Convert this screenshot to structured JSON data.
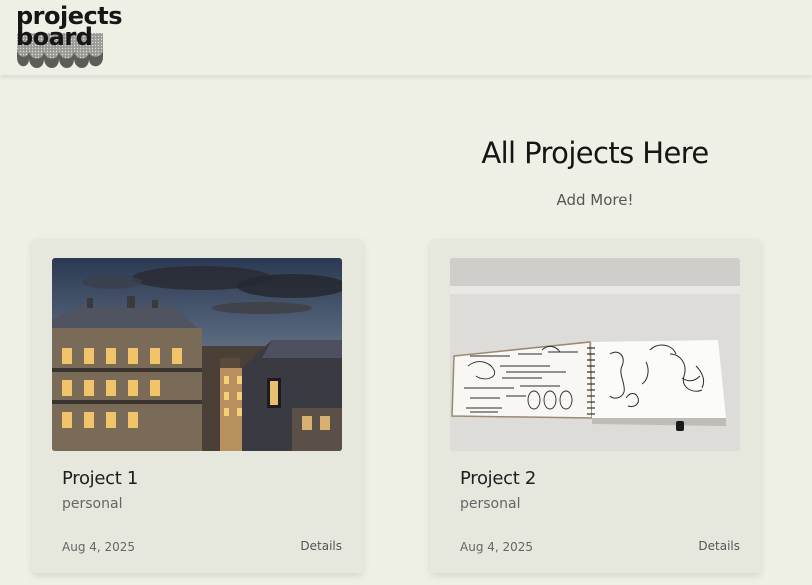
{
  "logo": {
    "line1": "projects",
    "line2": "board"
  },
  "main": {
    "title": "All Projects Here",
    "add_more": "Add More!"
  },
  "projects": [
    {
      "title": "Project 1",
      "category": "personal",
      "date": "Aug 4, 2025",
      "details_label": "Details",
      "image": "paris-rooftops-dusk"
    },
    {
      "title": "Project 2",
      "category": "personal",
      "date": "Aug 4, 2025",
      "details_label": "Details",
      "image": "sketchbook-drawings"
    }
  ],
  "colors": {
    "page_bg": "#eef0e6",
    "card_bg": "#e6e8de",
    "text_dark": "#1e1e1e",
    "text_muted": "#666666"
  }
}
